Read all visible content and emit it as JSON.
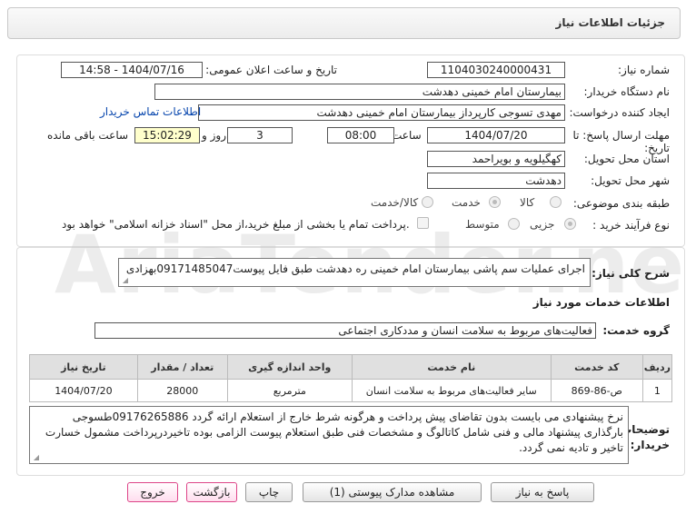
{
  "header": {
    "title": "جزئیات اطلاعات نیاز"
  },
  "form": {
    "need_number_label": "شماره نیاز:",
    "need_number": "1104030240000431",
    "announce_label": "تاریخ و ساعت اعلان عمومی:",
    "announce_value": "1404/07/16 - 14:58",
    "buyer_label": "نام دستگاه خریدار:",
    "buyer_value": "بیمارستان امام خمینی دهدشت",
    "creator_label": "ایجاد کننده درخواست:",
    "creator_value": "مهدی تسوجی کارپرداز بیمارستان امام خمینی دهدشت",
    "contact_link": "اطلاعات تماس خریدار",
    "deadline_label": "مهلت ارسال پاسخ: تا تاریخ:",
    "deadline_date": "1404/07/20",
    "time_label": "ساعت",
    "deadline_time": "08:00",
    "days_value": "3",
    "days_label": "روز و",
    "remaining_time": "15:02:29",
    "remaining_label": "ساعت باقی مانده",
    "province_label": "استان محل تحویل:",
    "province_value": "کهگیلویه و بویراحمد",
    "city_label": "شهر محل تحویل:",
    "city_value": "دهدشت",
    "category_label": "طبقه بندی موضوعی:",
    "category_options": [
      "کالا",
      "خدمت",
      "کالا/خدمت"
    ],
    "process_label": "نوع فرآیند خرید :",
    "process_options": [
      "جزیی",
      "متوسط"
    ],
    "payment_note": "پرداخت تمام یا بخشی از مبلغ خرید،از محل \"اسناد خزانه اسلامی\" خواهد بود."
  },
  "description": {
    "label": "شرح کلی نیاز:",
    "value": "اجرای عملیات سم پاشی بیمارستان امام خمینی ره دهدشت طبق فایل پیوست09171485047بهزادی"
  },
  "services": {
    "section_title": "اطلاعات خدمات مورد نیاز",
    "group_label": "گروه خدمت:",
    "group_value": "فعالیت‌های مربوط به سلامت انسان و مددکاری اجتماعی",
    "columns": [
      "ردیف",
      "کد خدمت",
      "نام خدمت",
      "واحد اندازه گیری",
      "تعداد / مقدار",
      "تاریخ نیاز"
    ],
    "rows": [
      [
        "1",
        "ص-86-869",
        "سایر فعالیت‌های مربوط به سلامت انسان",
        "مترمربع",
        "28000",
        "1404/07/20"
      ]
    ]
  },
  "buyer_notes": {
    "label": "توضیحات خریدار:",
    "value": "نرخ پیشنهادی می بایست بدون تقاضای پیش پرداخت و هرگونه شرط خارج از استعلام ارائه گردد 09176265886طسوجی بارگذاری پیشنهاد مالی و فنی شامل کاتالوگ و مشخصات فنی طبق استعلام پیوست الزامی بوده تاخیردرپرداخت مشمول خسارت تاخیر و تادیه نمی گردد."
  },
  "buttons": {
    "reply": "پاسخ به نیاز",
    "attachments": "مشاهده مدارک پیوستی (1)",
    "print": "چاپ",
    "back": "بازگشت",
    "exit": "خروج"
  }
}
